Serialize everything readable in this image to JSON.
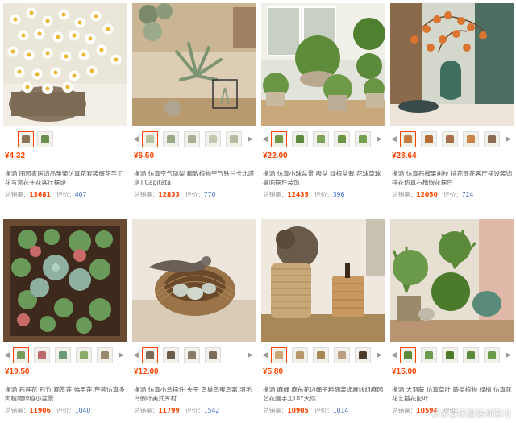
{
  "products": [
    {
      "price": "¥4.32",
      "title": "掬涵 田园家居饰品雏菊仿真花套装假花手工花写意花干花客厅摆设",
      "sales_label": "总销量：",
      "sales": "13681",
      "reviews_label": "评价：",
      "reviews": "407",
      "thumb_colors": [
        "#8b7355",
        "#6b8e4e"
      ],
      "bg": "#e9e4d8"
    },
    {
      "price": "¥6.50",
      "title": "掬涵 仿真空气凤梨 精致植物空气铁兰卡比塔塔T.Capitata",
      "sales_label": "总销量：",
      "sales": "12833",
      "reviews_label": "评价：",
      "reviews": "770",
      "thumb_colors": [
        "#b7c4a3",
        "#9aa985",
        "#a8b08f",
        "#c2c7b0",
        "#b3bca0"
      ],
      "bg": "#d9cbb2"
    },
    {
      "price": "¥22.00",
      "title": "掬涵 仿真小球盆景 吸盆 绿植盆栽 花球草球桌面摆件装饰",
      "sales_label": "总销量：",
      "sales": "12435",
      "reviews_label": "评价：",
      "reviews": "396",
      "thumb_colors": [
        "#6f9a4a",
        "#5f8a3e",
        "#7aa55a",
        "#6a9545",
        "#75a050"
      ],
      "bg": "#dfe3d8"
    },
    {
      "price": "¥28.64",
      "title": "掬涵 仿真石榴果树枝 插花假花客厅摆设装饰样花仿真石榴假花摆件",
      "sales_label": "总销量：",
      "sales": "12050",
      "reviews_label": "评价：",
      "reviews": "724",
      "thumb_colors": [
        "#c47a3a",
        "#b56d33",
        "#a8704a",
        "#c9844a",
        "#8a6a50"
      ],
      "bg": "#cfd8cf"
    },
    {
      "price": "¥19.50",
      "title": "掬涵 石莲花 石竹 观赏莲 佛手莲 芦荟仿真多肉植物绿植小盆景",
      "sales_label": "总销量：",
      "sales": "11906",
      "reviews_label": "评价：",
      "reviews": "1040",
      "thumb_colors": [
        "#7a9a5a",
        "#b86a6a",
        "#6a9a7a",
        "#8aaa6a",
        "#9a8a6a"
      ],
      "bg": "#6b4a32"
    },
    {
      "price": "¥12.00",
      "title": "掬涵 仿真小鸟摆件 夹子 鸟巢鸟蛋鸟窝 羽毛鸟假叶美式乡村",
      "sales_label": "总销量：",
      "sales": "11799",
      "reviews_label": "评价：",
      "reviews": "1542",
      "thumb_colors": [
        "#7a6a5a",
        "#6a5a4a",
        "#8a7a6a",
        "#7a6a5a"
      ],
      "bg": "#e8e0d4"
    },
    {
      "price": "¥5.80",
      "title": "掬涵 麻绳 麻布花边绳子粗细装饰麻线组麻园艺花圃手工DIY天然",
      "sales_label": "总销量：",
      "sales": "10905",
      "reviews_label": "评价：",
      "reviews": "1014",
      "thumb_colors": [
        "#c8a878",
        "#b89868",
        "#a88858",
        "#b8a080",
        "#4a3a2a"
      ],
      "bg": "#ece4d8"
    },
    {
      "price": "¥15.00",
      "title": "掬涵 大羽蕨 仿真草叶 蕨类植物 绿植 仿真花 花艺插花配叶",
      "sales_label": "总销量：",
      "sales": "10594",
      "reviews_label": "评价：",
      "reviews": "",
      "thumb_colors": [
        "#5a8a3a",
        "#6a9a4a",
        "#4a7a2a",
        "#5a8a3a",
        "#6a9a4a"
      ],
      "bg": "#e4ddd0"
    }
  ],
  "watermark": "头条@家居装饰陈设"
}
